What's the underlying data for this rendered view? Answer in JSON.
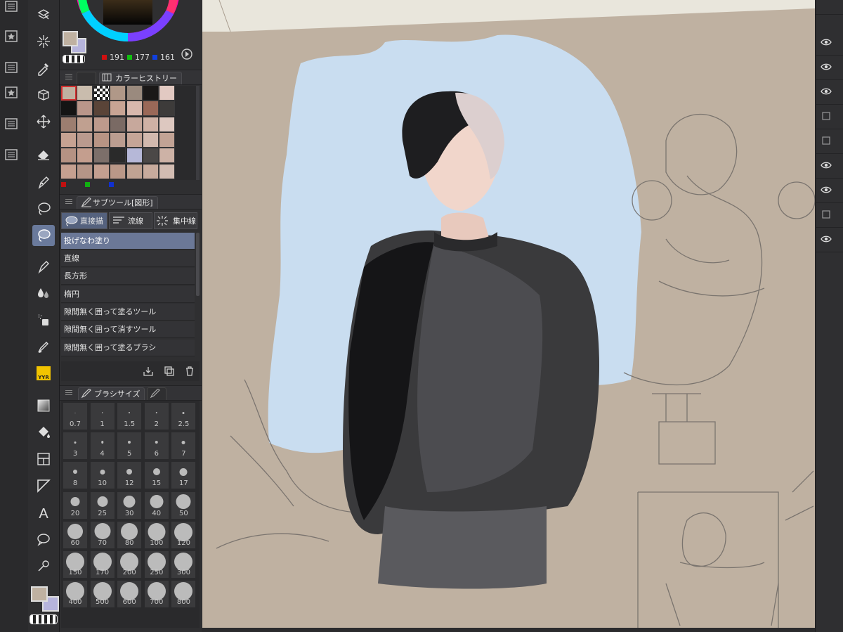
{
  "colors": {
    "main_color": "#bfb1a1",
    "sub_color": "#b6b4dc",
    "rgb": {
      "r": "191",
      "g": "177",
      "b": "161"
    }
  },
  "color_history": {
    "tab_label": "カラーヒストリー",
    "swatches": [
      "#bfb1a1",
      "#c9bcad",
      "transparent",
      "#b09888",
      "#9a8a7e",
      "#1a1818",
      "#e2c9c2",
      "#141414",
      "#b9968a",
      "#5a4438",
      "#c8a494",
      "#d8b8ad",
      "#9a6858",
      "#3d3b3a",
      "#9c7e70",
      "#c0a090",
      "#bd9a8c",
      "#7a6a64",
      "#c7a89c",
      "#cfb1a5",
      "#ddc8c0",
      "#c6a292",
      "#ba9a8e",
      "#b89484",
      "#bb9d90",
      "#c5a597",
      "#d2b9ae",
      "#c2a395",
      "#b59283",
      "#c49e8e",
      "#7c6f6a",
      "#2a2a2a",
      "#b6b8d8",
      "#4b4847",
      "#cdb2a6",
      "#c5a090",
      "#b59587",
      "#c39f90",
      "#ba9888",
      "#c0a393",
      "#c8ab9d",
      "#d2bcb2"
    ]
  },
  "subtool": {
    "tab_label": "サブツール[図形]",
    "tabs": [
      {
        "label": "直接描"
      },
      {
        "label": "流線"
      },
      {
        "label": "集中線"
      }
    ],
    "items": [
      {
        "label": "投げなわ塗り",
        "selected": true
      },
      {
        "label": "直線"
      },
      {
        "label": "長方形"
      },
      {
        "label": "楕円"
      },
      {
        "label": "隙間無く囲って塗るツール"
      },
      {
        "label": "隙間無く囲って消すツール"
      },
      {
        "label": "隙間無く囲って塗るブラシ"
      }
    ]
  },
  "brush_size": {
    "tab_label": "ブラシサイズ",
    "sizes": [
      "0.7",
      "1",
      "1.5",
      "2",
      "2.5",
      "3",
      "4",
      "5",
      "6",
      "7",
      "8",
      "10",
      "12",
      "15",
      "17",
      "20",
      "25",
      "30",
      "40",
      "50",
      "60",
      "70",
      "80",
      "100",
      "120",
      "150",
      "170",
      "200",
      "250",
      "300",
      "400",
      "500",
      "600",
      "700",
      "800"
    ]
  },
  "toolbar": {
    "yyr_label": "YYR",
    "text_tool_label": "A"
  },
  "layers": {
    "visibility": [
      true,
      true,
      true,
      false,
      false,
      true,
      true,
      false,
      true
    ]
  }
}
